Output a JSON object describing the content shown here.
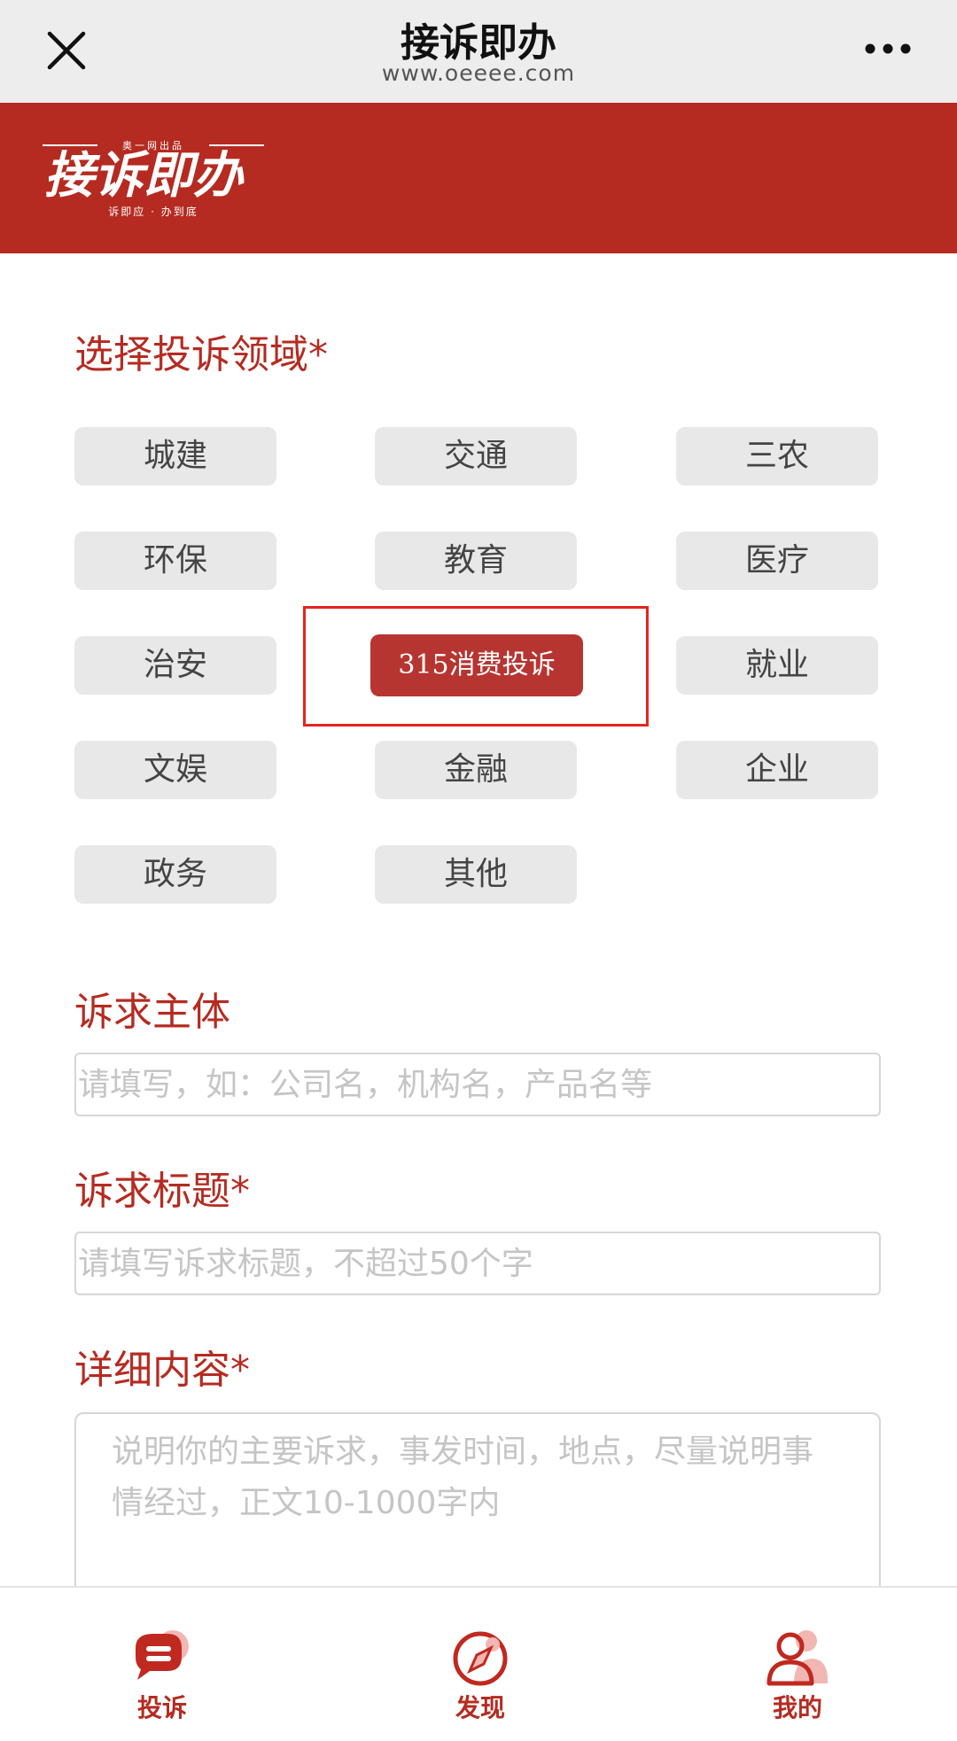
{
  "navbar": {
    "title": "接诉即办",
    "url": "www.oeeee.com"
  },
  "banner": {
    "logo_top": "奥一网出品",
    "logo_main": "接诉即办",
    "logo_sub": "诉即应 · 办到底"
  },
  "category_section": {
    "title": "选择投诉领域*",
    "categories": [
      "城建",
      "交通",
      "三农",
      "环保",
      "教育",
      "医疗",
      "治安",
      "315消费投诉",
      "就业",
      "文娱",
      "金融",
      "企业",
      "政务",
      "其他"
    ],
    "selected": "315消费投诉"
  },
  "subject": {
    "label": "诉求主体",
    "placeholder": "请填写，如：公司名，机构名，产品名等"
  },
  "title_field": {
    "label": "诉求标题*",
    "placeholder": "请填写诉求标题，不超过50个字"
  },
  "detail": {
    "label": "详细内容*",
    "placeholder": "说明你的主要诉求，事发时间，地点，尽量说明事情经过，正文10-1000字内"
  },
  "tabbar": {
    "tabs": [
      {
        "label": "投诉",
        "icon": "chat-bubble-icon"
      },
      {
        "label": "发现",
        "icon": "compass-icon"
      },
      {
        "label": "我的",
        "icon": "user-icon"
      }
    ]
  },
  "colors": {
    "brand_red": "#b52b21",
    "selected_button": "#b73531",
    "highlight_border": "#e8231e",
    "button_gray": "#e8e8e8"
  }
}
